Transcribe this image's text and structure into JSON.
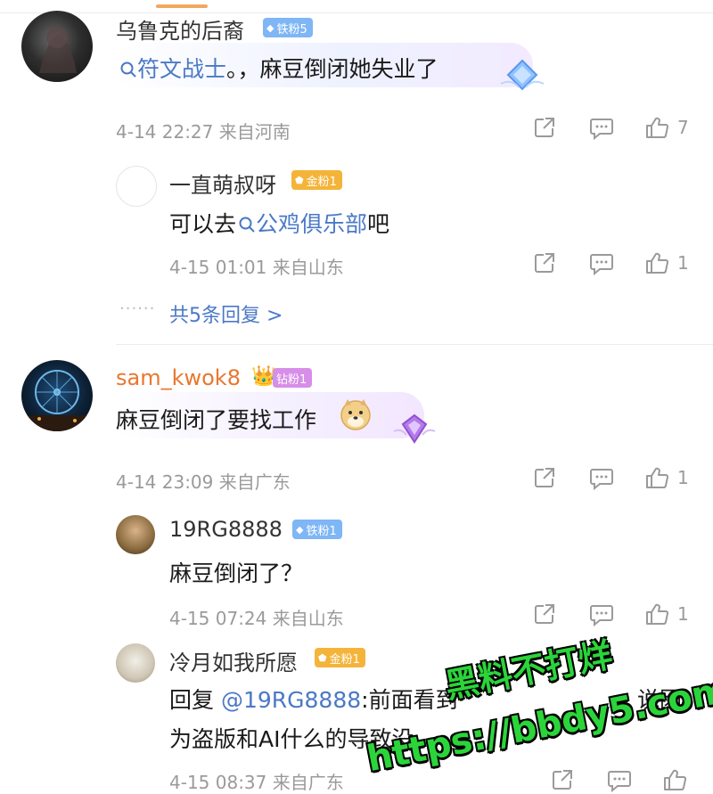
{
  "comments": [
    {
      "author": "乌鲁克的后裔",
      "badge": "铁粉5",
      "link_text": "符文战士",
      "text_after": "。，麻豆倒闭她失业了",
      "time": "4-14 22:27",
      "location": "来自河南",
      "likes": "7",
      "replies": [
        {
          "author": "一直萌叔呀",
          "badge": "金粉1",
          "text_before": "可以去",
          "link_text": "公鸡俱乐部",
          "text_after": "吧",
          "time": "4-15 01:01",
          "location": "来自山东",
          "likes": "1"
        }
      ],
      "more_replies": "共5条回复 >"
    },
    {
      "author": "sam_kwok8",
      "badge": "钻粉1",
      "text": "麻豆倒闭了要找工作",
      "time": "4-14 23:09",
      "location": "来自广东",
      "likes": "1",
      "replies": [
        {
          "author": "19RG8888",
          "badge": "铁粉1",
          "text": "麻豆倒闭了？",
          "time": "4-15 07:24",
          "location": "来自山东",
          "likes": "1"
        },
        {
          "author": "冷月如我所愿",
          "badge": "金粉1",
          "reply_prefix": "回复 ",
          "mention": "@19RG8888",
          "line1_rest": ":前面看到",
          "line1_tail": "，说因",
          "line2": "为盗版和AI什么的导致没",
          "time": "4-15 08:37",
          "location": "来自广东"
        }
      ]
    }
  ],
  "watermark": {
    "line1": "黑料不打烊",
    "line2": "https://bbdy5.com"
  },
  "colors": {
    "link": "#4b79c7",
    "meta": "#9a9a9a",
    "iron_badge": "#7fb6f5",
    "gold_badge": "#f4b43a",
    "diamond_badge": "#d78ee8",
    "watermark": "#2bd43a"
  },
  "icons": [
    "search-icon",
    "share-icon",
    "comment-icon",
    "like-icon",
    "diamond-decoration-icon",
    "doge-emoji-icon",
    "crown-icon"
  ]
}
